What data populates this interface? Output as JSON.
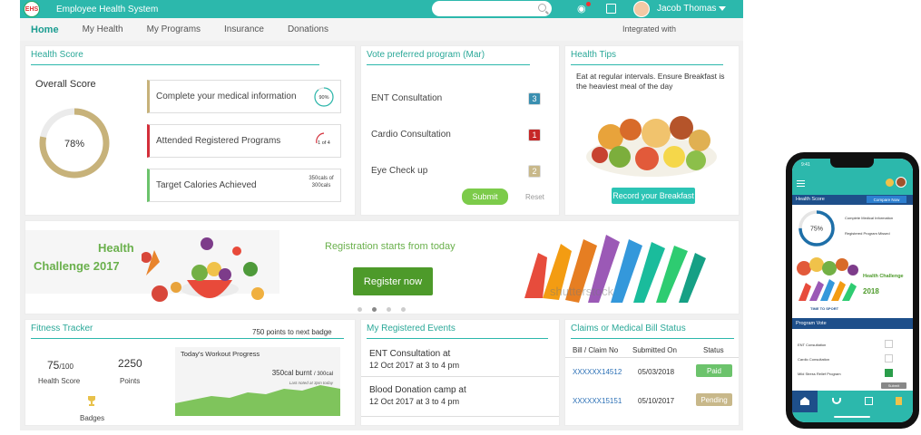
{
  "header": {
    "logo_text": "EHS",
    "app_title": "Employee Health System",
    "search_placeholder": "",
    "user_name": "Jacob Thomas"
  },
  "nav": {
    "items": [
      "Home",
      "My Health",
      "My Programs",
      "Insurance",
      "Donations"
    ],
    "active": "Home",
    "integrated_label": "Integrated with"
  },
  "health_score": {
    "title": "Health Score",
    "overall_label": "Overall Score",
    "overall_value": "78%",
    "overall_fraction": 0.78,
    "items": [
      {
        "label": "Complete your medical information",
        "indicator": "90%",
        "color": "#c7b27a"
      },
      {
        "label": "Attended Registered Programs",
        "indicator": "1 of 4",
        "color": "#d32f3a"
      },
      {
        "label": "Target Calories Achieved",
        "indicator": "350cals of 300cals",
        "color": "#6cc36c"
      }
    ]
  },
  "vote": {
    "title": "Vote preferred program (Mar)",
    "options": [
      {
        "label": "ENT Consultation",
        "count": "3",
        "color": "#3a8fb0"
      },
      {
        "label": "Cardio Consultation",
        "count": "1",
        "color": "#c62828"
      },
      {
        "label": "Eye Check up",
        "count": "2",
        "color": "#c8b88a"
      }
    ],
    "submit_label": "Submit",
    "reset_label": "Reset"
  },
  "health_tips": {
    "title": "Health Tips",
    "text": "Eat at regular intervals. Ensure Breakfast is the heaviest meal of the day",
    "button_label": "Record your Breakfast"
  },
  "banner": {
    "challenge_line1": "Health",
    "challenge_line2": "Challenge 2017",
    "registration_text": "Registration starts from today",
    "register_label": "Register now",
    "watermark": "shutterstock",
    "slides": 4,
    "active_slide": 1
  },
  "fitness": {
    "title": "Fitness Tracker",
    "next_badge": "750 points to next badge",
    "score_value": "75",
    "score_max": "/100",
    "score_label": "Health Score",
    "points_value": "2250",
    "points_label": "Points",
    "badges_label": "Badges",
    "workout_title": "Today's Workout Progress",
    "calories_text": "350cal burnt",
    "calories_target": "/ 300cal",
    "last_noted": "Last noted at 3pm today"
  },
  "events": {
    "title": "My Registered Events",
    "items": [
      {
        "name": "ENT Consultation at",
        "when": "12 Oct 2017 at 3 to 4 pm"
      },
      {
        "name": "Blood Donation camp at",
        "when": "12 Oct 2017 at 3 to 4 pm"
      }
    ]
  },
  "claims": {
    "title": "Claims or Medical Bill Status",
    "headers": [
      "Bill / Claim No",
      "Submitted On",
      "Status"
    ],
    "rows": [
      {
        "bill": "XXXXXX14512",
        "date": "05/03/2018",
        "status": "Paid",
        "color": "#6cc36c"
      },
      {
        "bill": "XXXXXX15151",
        "date": "05/10/2017",
        "status": "Pending",
        "color": "#c8b88a"
      }
    ]
  },
  "phone": {
    "time": "9:41",
    "health_score_label": "Health Score",
    "compare_label": "Compare Now",
    "score_value": "75%",
    "score_fraction": 0.75,
    "score_items": [
      "Complete Medical Information",
      "Registered Program Missed"
    ],
    "challenge_label": "Health Challenge",
    "challenge_year": "2018",
    "sport_text": "TIME TO SPORT",
    "vote_title": "Program Vote",
    "vote_items": [
      "ENT Consultation",
      "Cardio Consultation",
      "Mild Stress Relief Program"
    ],
    "submit_label": "Submit"
  }
}
